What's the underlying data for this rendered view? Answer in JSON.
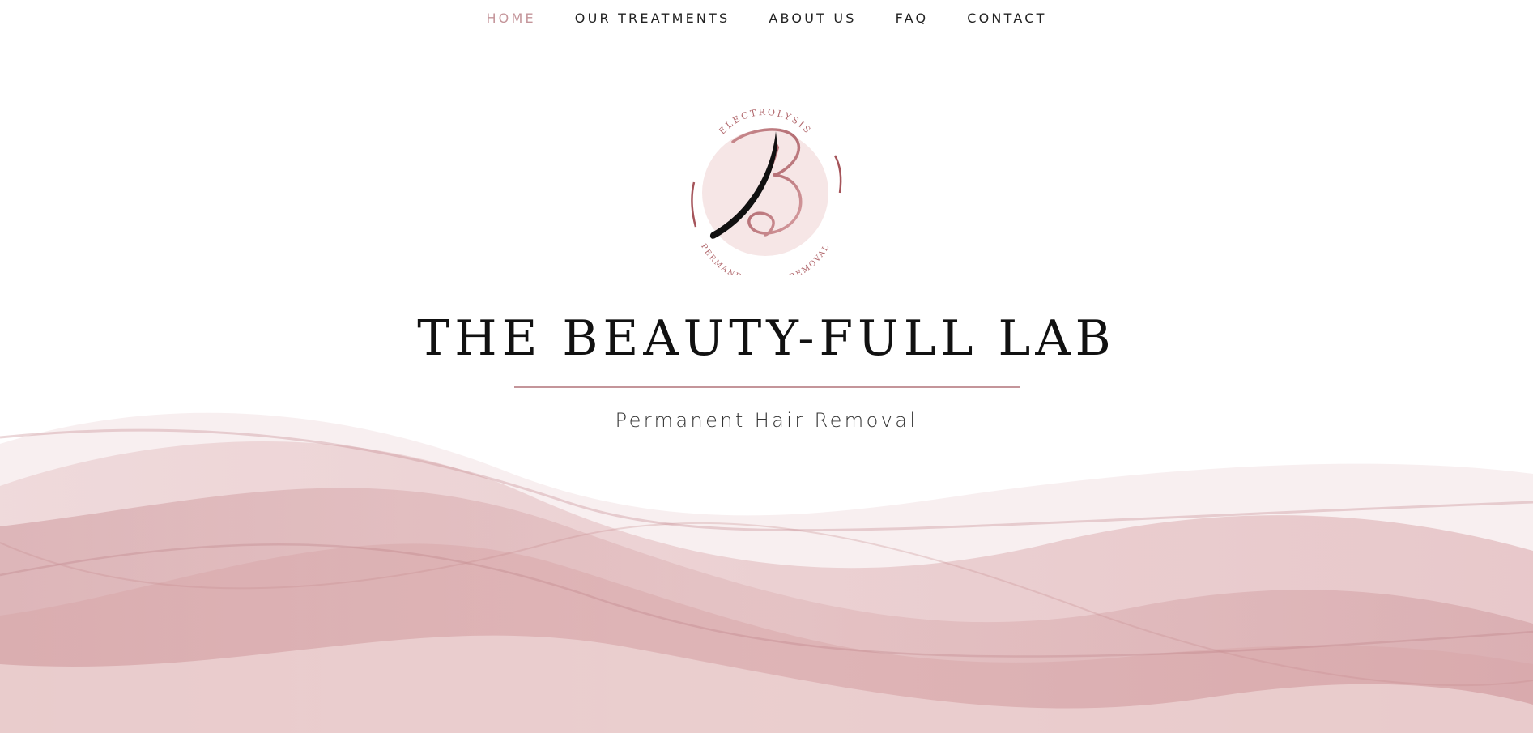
{
  "nav": {
    "items": [
      {
        "label": "HOME",
        "active": true
      },
      {
        "label": "OUR TREATMENTS",
        "active": false
      },
      {
        "label": "ABOUT US",
        "active": false
      },
      {
        "label": "FAQ",
        "active": false
      },
      {
        "label": "CONTACT",
        "active": false
      }
    ]
  },
  "logo": {
    "top_text": "ELECTROLYSIS",
    "bottom_text": "PERMANENT HAIR REMOVAL",
    "icon": "monogram-b-hair-icon"
  },
  "hero": {
    "title": "THE BEAUTY-FULL LAB",
    "subtitle": "Permanent Hair Removal"
  },
  "colors": {
    "accent": "#c4959a",
    "text": "#111111",
    "wave": "#d9a9ab"
  }
}
